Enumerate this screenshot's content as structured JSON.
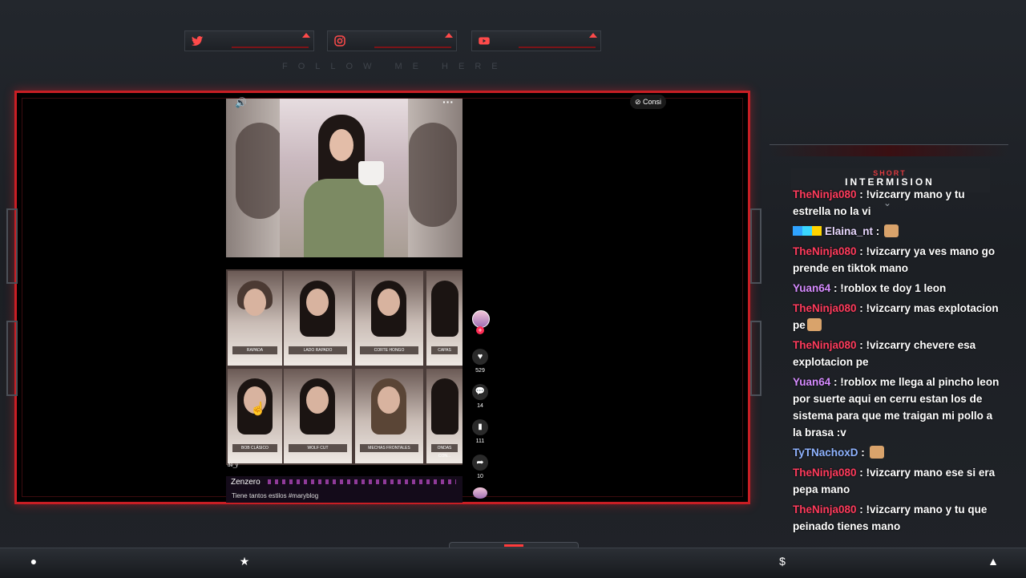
{
  "overlay": {
    "follow_text": "FOLLOW ME HERE",
    "intermission": {
      "short": "SHORT",
      "title": "INTERMISION"
    },
    "accent": "#c81e24"
  },
  "social": [
    {
      "icon": "twitter-icon"
    },
    {
      "icon": "instagram-icon"
    },
    {
      "icon": "youtube-icon"
    }
  ],
  "video": {
    "consult_label": "Consi",
    "grid": [
      "RAPADA",
      "LADO RAPADO",
      "CORTE HONGO",
      "CAPAS",
      "BOB CLÁSICO",
      "WOLF CUT",
      "MECHAS FRONTALES",
      "ONDAS CON..."
    ],
    "side_text": "de_y",
    "counts": {
      "likes": "529",
      "comments": "14",
      "saves": "111",
      "shares": "10"
    },
    "author": "Zenzero",
    "caption": "Tiene tantos estilos #maryblog"
  },
  "chat": [
    {
      "user": "TheNinja080",
      "color": "#ff3b5c",
      "text": " : !vizcarry mano y tu estrella no la vi"
    },
    {
      "user": "Elaina_nt",
      "color": "#e9d8ff",
      "text": " : ",
      "badges": true,
      "emote": true
    },
    {
      "user": "TheNinja080",
      "color": "#ff3b5c",
      "text": " : !vizcarry ya ves mano go prende en tiktok mano"
    },
    {
      "user": "Yuan64",
      "color": "#d68bff",
      "text": " : !roblox te doy 1 leon"
    },
    {
      "user": "TheNinja080",
      "color": "#ff3b5c",
      "text": " : !vizcarry mas explotacion pe",
      "emote": true
    },
    {
      "user": "TheNinja080",
      "color": "#ff3b5c",
      "text": " : !vizcarry chevere esa explotacion pe"
    },
    {
      "user": "Yuan64",
      "color": "#d68bff",
      "text": " : !roblox me llega al pincho leon por suerte aqui en cerru estan los de sistema para que me traigan mi pollo a la brasa :v"
    },
    {
      "user": "TyTNachoxD",
      "color": "#8fb3ff",
      "text": " : ",
      "emote": true
    },
    {
      "user": "TheNinja080",
      "color": "#ff3b5c",
      "text": " : !vizcarry mano ese si era pepa mano"
    },
    {
      "user": "TheNinja080",
      "color": "#ff3b5c",
      "text": " : !vizcarry mano y tu que peinado tienes mano"
    }
  ]
}
